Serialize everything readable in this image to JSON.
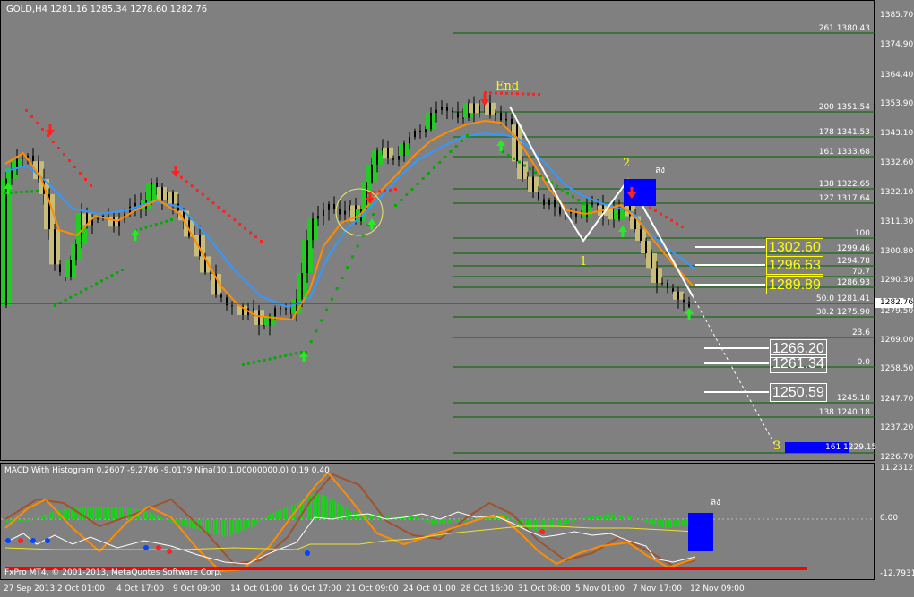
{
  "chart_header": "GOLD,H4  1281.16 1285.34 1278.60 1282.76",
  "price_axis": [
    "1385.70",
    "1374.90",
    "1364.40",
    "1353.90",
    "1343.10",
    "1332.60",
    "1322.10",
    "1311.30",
    "1300.80",
    "1290.30",
    "1282.76",
    "1279.50",
    "1269.00",
    "1258.50",
    "1247.70",
    "1237.20",
    "1226.70"
  ],
  "current_price": "1282.76",
  "fib_labels": [
    "261  1380.43",
    "200  1351.54",
    "178  1341.53",
    "161  1333.68",
    "138  1322.65",
    "127  1317.64",
    "100",
    "1299.46",
    "1294.78",
    "70.7",
    "1286.93",
    "50.0  1281.41",
    "38.2  1275.90",
    "23.6",
    "0.0",
    "1245.18",
    "138  1240.18"
  ],
  "target_boxes": [
    "1302.60",
    "1296.63",
    "1289.89",
    "1266.20",
    "1261.34",
    "1250.59"
  ],
  "wave_labels": {
    "end": "End",
    "one": "1",
    "two": "2",
    "three": "3"
  },
  "annotation_top": "ลง",
  "annotation_macd": "ลง",
  "blue_box_label": "161  1229.15",
  "macd_title": "MACD With Histogram  0.2607 -9.2786 -9.0179  Nina(10,1.00000000,0) 0.19 0.40",
  "macd_axis": [
    "11.2312",
    "0.00",
    "-12.7931"
  ],
  "copyright": "FxPro MT4, © 2001-2013, MetaQuotes Software Corp.",
  "time_axis": [
    "27 Sep 2013",
    "2 Oct 01:00",
    "4 Oct 17:00",
    "9 Oct 09:00",
    "14 Oct 01:00",
    "16 Oct 17:00",
    "21 Oct 09:00",
    "24 Oct 01:00",
    "28 Oct 16:00",
    "31 Oct 08:00",
    "5 Nov 01:00",
    "7 Nov 17:00",
    "12 Nov 09:00"
  ],
  "colors": {
    "bg": "#808080",
    "bull": "#22cc22",
    "bear": "#c8bd78",
    "fib": "#006400",
    "ma_fast": "#ff8c00",
    "ma_slow": "#3399ff",
    "sar_up": "#00aa00",
    "sar_down": "#ff2020",
    "macd_line": "#e07020",
    "signal": "#a0522d",
    "hist": "#22cc22",
    "zero_red": "#ff0000"
  }
}
